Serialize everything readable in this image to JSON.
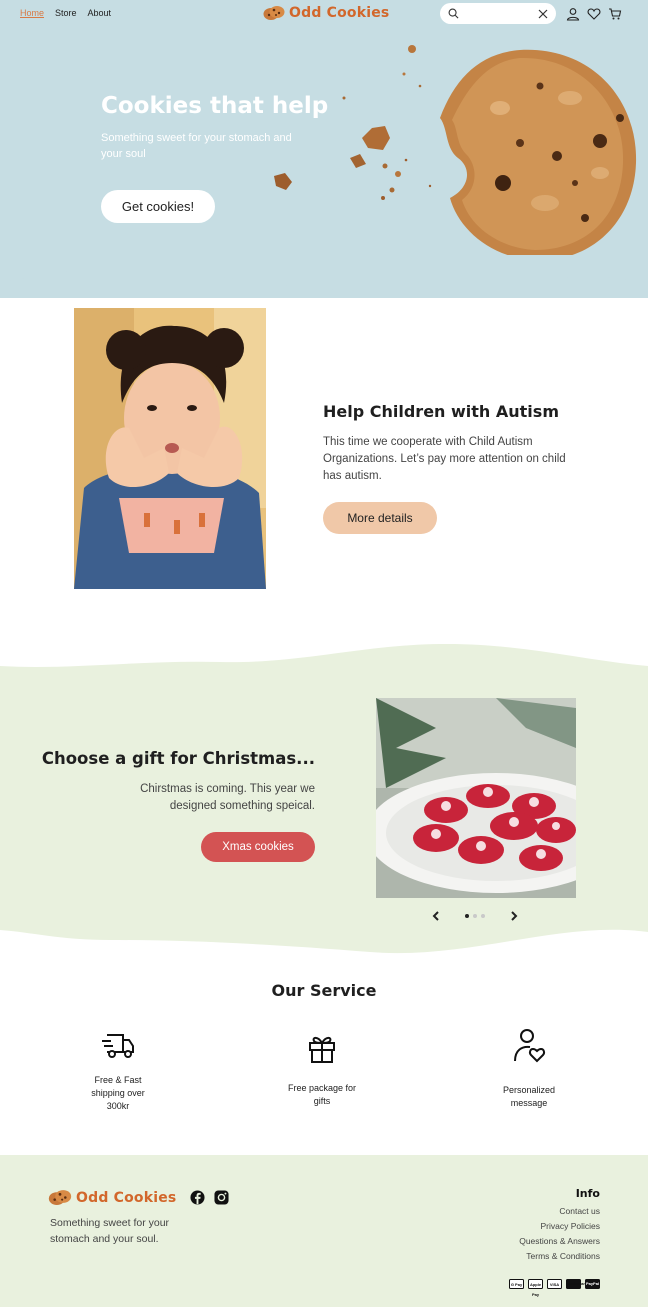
{
  "nav": {
    "items": [
      {
        "label": "Home",
        "active": true
      },
      {
        "label": "Store",
        "active": false
      },
      {
        "label": "About",
        "active": false
      }
    ]
  },
  "brand": {
    "name": "Odd Cookies",
    "color": "#d2672b"
  },
  "search": {
    "value": "",
    "placeholder": ""
  },
  "header_icons": [
    "user-icon",
    "heart-icon",
    "cart-icon"
  ],
  "hero": {
    "title": "Cookies that help",
    "subtitle": "Something sweet for your stomach and your soul",
    "button": "Get cookies!",
    "bg": "#c6dde3"
  },
  "autism": {
    "title": "Help Children with Autism",
    "text": "This time we cooperate with Child Autism Organizations. Let’s pay more attention on child has autism.",
    "button": "More details"
  },
  "xmas": {
    "title": "Choose a gift for Christmas...",
    "text": "Chirstmas is coming. This year we designed something speical.",
    "button": "Xmas cookies",
    "slides": 3,
    "active_slide": 1
  },
  "service": {
    "title": "Our Service",
    "items": [
      {
        "label": "Free & Fast shipping over 300kr",
        "icon": "truck-icon"
      },
      {
        "label": "Free package for gifts",
        "icon": "gift-icon"
      },
      {
        "label": "Personalized message",
        "icon": "user-heart-icon"
      }
    ]
  },
  "footer": {
    "brand": "Odd Cookies",
    "tagline": "Something sweet for your stomach and your soul.",
    "social": [
      "facebook-icon",
      "instagram-icon"
    ],
    "info_title": "Info",
    "links": [
      "Contact us",
      "Privacy Policies",
      "Questions & Answers",
      "Terms & Conditions"
    ],
    "payments": [
      "G Pay",
      "Apple Pay",
      "VISA",
      "Mastercard",
      "PayPal"
    ]
  }
}
